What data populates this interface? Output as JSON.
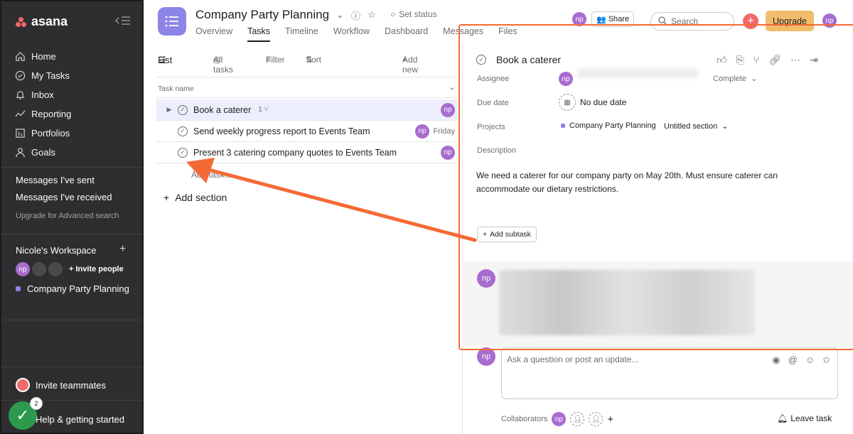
{
  "sidebar": {
    "logo_text": "asana",
    "nav": [
      {
        "label": "Home",
        "icon": "home-icon"
      },
      {
        "label": "My Tasks",
        "icon": "check-circle-icon"
      },
      {
        "label": "Inbox",
        "icon": "bell-icon"
      },
      {
        "label": "Reporting",
        "icon": "line-chart-icon"
      },
      {
        "label": "Portfolios",
        "icon": "bar-chart-icon"
      },
      {
        "label": "Goals",
        "icon": "person-icon"
      }
    ],
    "messages_sent": "Messages I've sent",
    "messages_received": "Messages I've received",
    "upgrade_search": "Upgrade for Advanced search",
    "workspace_title": "Nicole's Workspace",
    "invite_people": "Invite people",
    "project": "Company Party Planning",
    "invite_teammates": "Invite teammates",
    "help": "Help & getting started",
    "help_badge_count": "2",
    "avatar_initials": "np"
  },
  "header": {
    "project_title": "Company Party Planning",
    "set_status": "Set status",
    "tabs": [
      "Overview",
      "Tasks",
      "Timeline",
      "Workflow",
      "Dashboard",
      "Messages",
      "Files"
    ],
    "share": "Share",
    "search_placeholder": "Search",
    "upgrade": "Upgrade"
  },
  "toolbar": {
    "list": "List",
    "all_tasks": "All tasks",
    "filter": "Filter",
    "sort": "Sort",
    "add_new": "Add new"
  },
  "tasklist": {
    "column_header": "Task name",
    "tasks": [
      {
        "name": "Book a caterer",
        "subtask_count": "1",
        "assignee": "np",
        "due": ""
      },
      {
        "name": "Send weekly progress report to Events Team",
        "subtask_count": "",
        "assignee": "np",
        "due": "Friday"
      },
      {
        "name": "Present 3 catering company quotes to Events Team",
        "subtask_count": "",
        "assignee": "np",
        "due": ""
      }
    ],
    "add_task": "Add task...",
    "add_section": "Add section"
  },
  "detail": {
    "title": "Book a caterer",
    "assignee_label": "Assignee",
    "assignee_value": "np",
    "status_value": "Complete",
    "due_label": "Due date",
    "due_value": "No due date",
    "projects_label": "Projects",
    "project_value": "Company Party Planning",
    "section_value": "Untitled section",
    "description_label": "Description",
    "description": "We need a caterer for our company party on May 20th. Must ensure caterer can accommodate our dietary restrictions.",
    "add_subtask": "Add subtask",
    "comment_placeholder": "Ask a question or post an update...",
    "collaborators_label": "Collaborators",
    "leave_task": "Leave task"
  },
  "colors": {
    "brand": "#f06a6a",
    "sidebar_bg": "#2e2e30",
    "project_purple": "#8d84e8",
    "avatar_purple": "#a86ccf",
    "upgrade_yellow": "#f1bd6c",
    "annotation_orange": "#f46a35"
  }
}
